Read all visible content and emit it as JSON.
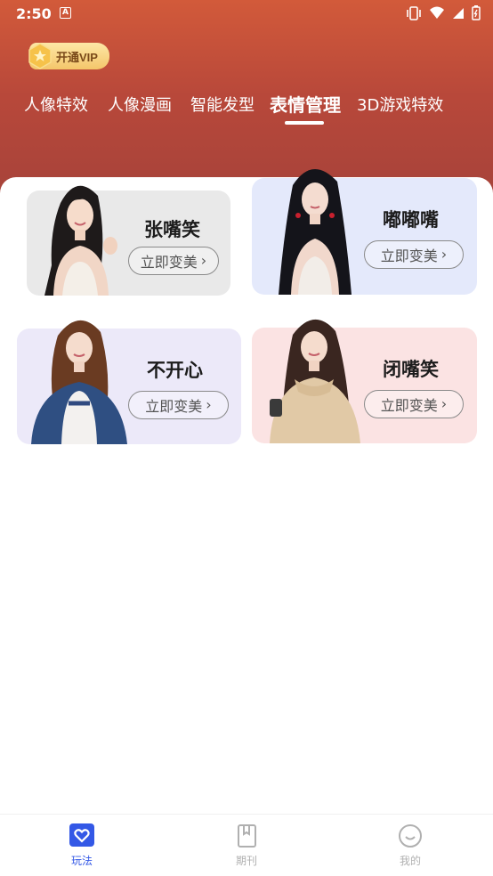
{
  "status": {
    "time": "2:50",
    "notif": "A"
  },
  "vip": {
    "label": "开通VIP"
  },
  "tabs": [
    {
      "label": "人像特效"
    },
    {
      "label": "人像漫画"
    },
    {
      "label": "智能发型"
    },
    {
      "label": "表情管理"
    },
    {
      "label": "3D游戏特效"
    }
  ],
  "cards": [
    {
      "title": "张嘴笑",
      "button": "立即变美"
    },
    {
      "title": "嘟嘟嘴",
      "button": "立即变美"
    },
    {
      "title": "不开心",
      "button": "立即变美"
    },
    {
      "title": "闭嘴笑",
      "button": "立即变美"
    }
  ],
  "nav": [
    {
      "label": "玩法"
    },
    {
      "label": "期刊"
    },
    {
      "label": "我的"
    }
  ],
  "colors": {
    "header_top": "#d25a3a",
    "header_bottom": "#a4423a",
    "nav_active": "#3358e6",
    "nav_inactive": "#b0b0b0"
  }
}
